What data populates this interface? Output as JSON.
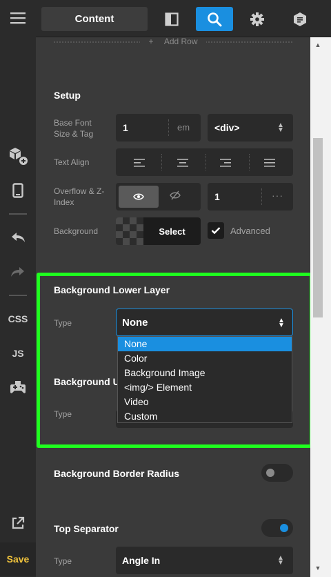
{
  "rail": {
    "menu_icon": "hamburger-icon",
    "add_element_icon": "cubes-add-icon",
    "device_icon": "mobile-device-icon",
    "undo_icon": "undo-icon",
    "redo_icon": "redo-icon",
    "css_label": "CSS",
    "js_label": "JS",
    "gamepad_icon": "gamepad-icon",
    "external_icon": "external-link-icon",
    "save_label": "Save"
  },
  "topbar": {
    "content_tab": "Content",
    "icons": [
      "layout-panel-icon",
      "search-icon",
      "gear-icon",
      "shield-icon"
    ]
  },
  "panel": {
    "add_row": "Add Row",
    "setup": {
      "title": "Setup",
      "base_font_label": "Base Font Size & Tag",
      "font_size_value": "1",
      "font_size_unit": "em",
      "tag_value": "<div>",
      "text_align_label": "Text Align",
      "overflow_label": "Overflow & Z-Index",
      "z_index_value": "1",
      "background_label": "Background",
      "select_button": "Select",
      "advanced_label": "Advanced",
      "advanced_checked": true
    },
    "lower_layer": {
      "title": "Background Lower Layer",
      "type_label": "Type",
      "type_value": "None",
      "options": [
        "None",
        "Color",
        "Background Image",
        "<img/> Element",
        "Video",
        "Custom"
      ],
      "selected_index": 0
    },
    "upper_layer": {
      "title_visible": "Background U",
      "type_label": "Type"
    },
    "border_radius": {
      "title": "Background Border Radius",
      "enabled": false
    },
    "top_separator": {
      "title": "Top Separator",
      "enabled": true,
      "type_label": "Type",
      "type_value": "Angle In"
    }
  },
  "colors": {
    "accent": "#1a8fe0",
    "highlight": "#1fff1f",
    "save": "#f0c33c"
  }
}
